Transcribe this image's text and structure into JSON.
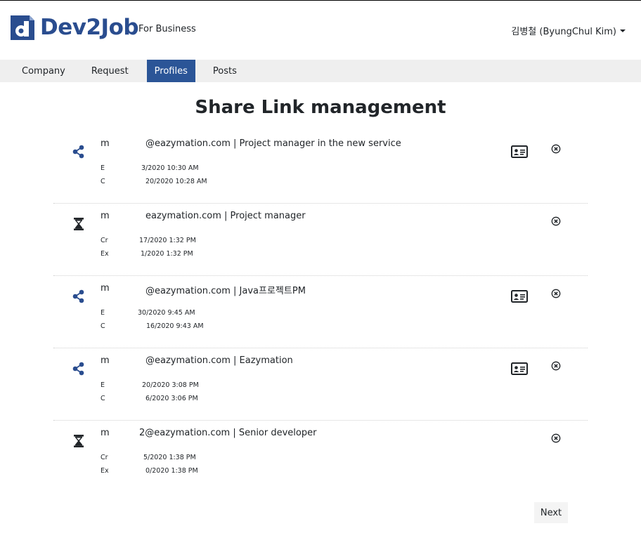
{
  "header": {
    "logo_text": "Dev2Job",
    "subtitle": "For Business",
    "user_name": "김병철 (ByungChul Kim)"
  },
  "nav": {
    "tabs": [
      {
        "label": "Company"
      },
      {
        "label": "Request"
      },
      {
        "label": "Profiles",
        "active": true
      },
      {
        "label": "Posts"
      }
    ]
  },
  "page_title": "Share Link management",
  "items": [
    {
      "status_icon": "share-icon",
      "prefix": "m",
      "title": "@eazymation.com | Project manager in the new service",
      "line2_prefix": "E",
      "line2": "3/2020 10:30 AM",
      "line3_prefix": "C",
      "line3": "20/2020 10:28 AM",
      "has_card": true
    },
    {
      "status_icon": "hourglass-icon",
      "prefix": "m",
      "title": "eazymation.com | Project manager",
      "line2_prefix": "Cr",
      "line2": "17/2020 1:32 PM",
      "line3_prefix": "Ex",
      "line3": "1/2020 1:32 PM",
      "has_card": false
    },
    {
      "status_icon": "share-icon",
      "prefix": "m",
      "title": "@eazymation.com | Java프로젝트PM",
      "line2_prefix": "E",
      "line2": "30/2020 9:45 AM",
      "line3_prefix": "C",
      "line3": "16/2020 9:43 AM",
      "has_card": true
    },
    {
      "status_icon": "share-icon",
      "prefix": "m",
      "title": "@eazymation.com | Eazymation",
      "line2_prefix": "E",
      "line2": "20/2020 3:08 PM",
      "line3_prefix": "C",
      "line3": "6/2020 3:06 PM",
      "has_card": true
    },
    {
      "status_icon": "hourglass-icon",
      "prefix": "m",
      "title": "2@eazymation.com | Senior developer",
      "line2_prefix": "Cr",
      "line2": "5/2020 1:38 PM",
      "line3_prefix": "Ex",
      "line3": "0/2020 1:38 PM",
      "has_card": false
    }
  ],
  "pagination": {
    "next_label": "Next"
  },
  "colors": {
    "brand": "#2a4d8f",
    "active_tab": "#2b5597",
    "nav_bg": "#efefef"
  }
}
